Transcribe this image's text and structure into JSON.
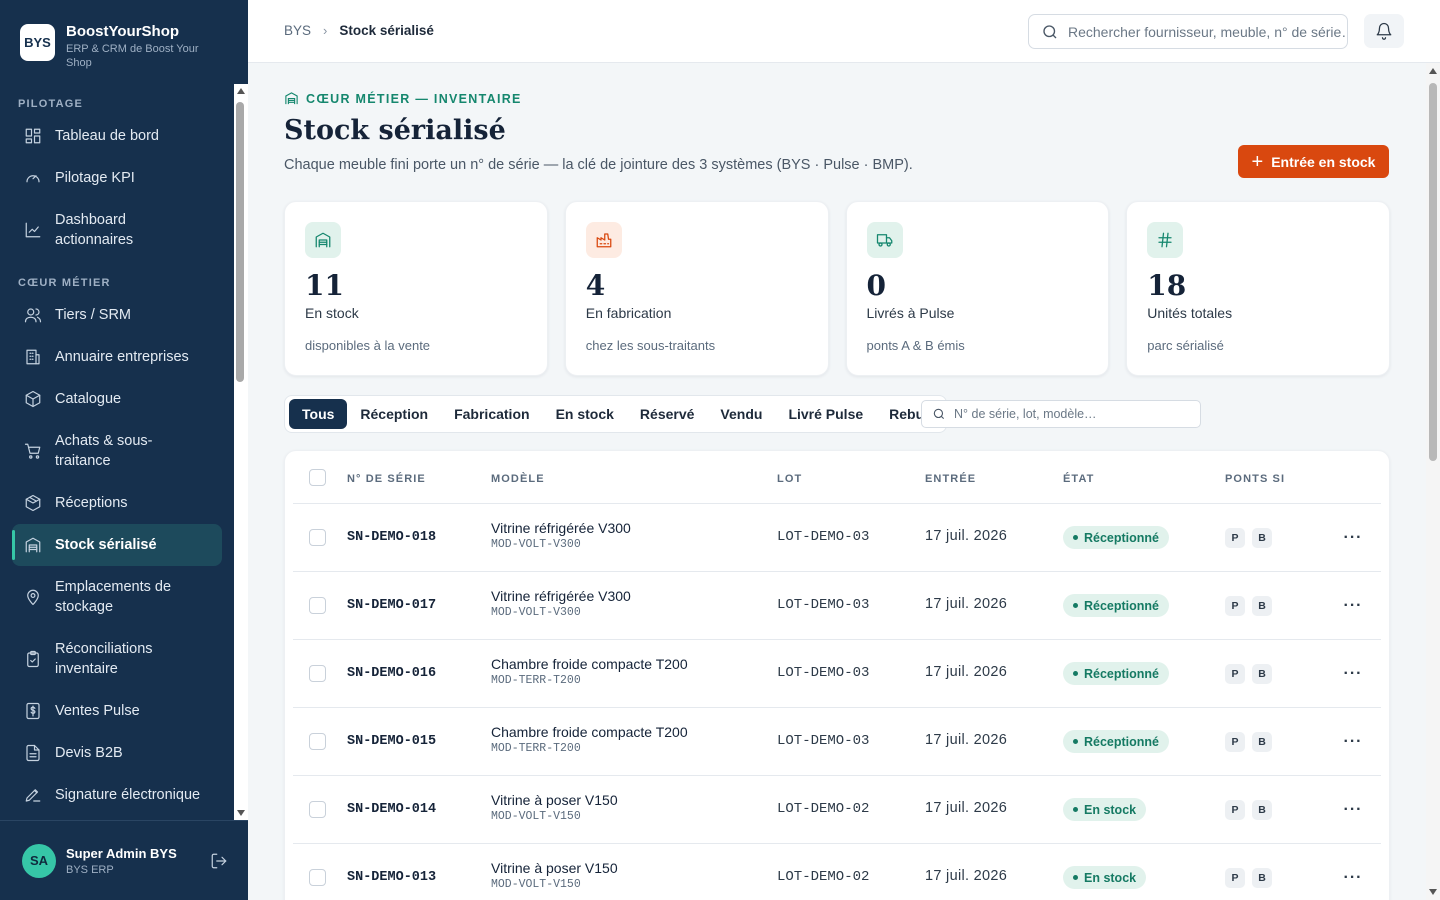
{
  "brand": {
    "logo": "BYS",
    "name": "BoostYourShop",
    "subtitle": "ERP & CRM de Boost Your Shop"
  },
  "sidebar": {
    "section_pilotage": "PILOTAGE",
    "section_coeur": "CŒUR MÉTIER",
    "items": [
      {
        "label": "Tableau de bord",
        "icon": "dashboard-icon"
      },
      {
        "label": "Pilotage KPI",
        "icon": "gauge-icon"
      },
      {
        "label": "Dashboard actionnaires",
        "icon": "chart-line-icon"
      },
      {
        "label": "Tiers / SRM",
        "icon": "users-icon"
      },
      {
        "label": "Annuaire entreprises",
        "icon": "building-icon"
      },
      {
        "label": "Catalogue",
        "icon": "box-icon"
      },
      {
        "label": "Achats & sous-traitance",
        "icon": "cart-icon"
      },
      {
        "label": "Réceptions",
        "icon": "package-check-icon"
      },
      {
        "label": "Stock sérialisé",
        "icon": "warehouse-icon"
      },
      {
        "label": "Emplacements de stockage",
        "icon": "map-pin-icon"
      },
      {
        "label": "Réconciliations inventaire",
        "icon": "clipboard-check-icon"
      },
      {
        "label": "Ventes Pulse",
        "icon": "dollar-file-icon"
      },
      {
        "label": "Devis B2B",
        "icon": "file-text-icon"
      },
      {
        "label": "Signature électronique",
        "icon": "signature-icon"
      }
    ],
    "active_index": 8
  },
  "user": {
    "initials": "SA",
    "name": "Super Admin BYS",
    "role": "BYS ERP"
  },
  "header": {
    "breadcrumb_root": "BYS",
    "breadcrumb_current": "Stock sérialisé",
    "search_placeholder": "Rechercher fournisseur, meuble, n° de série…"
  },
  "page": {
    "eyebrow": "CŒUR MÉTIER — INVENTAIRE",
    "title": "Stock sérialisé",
    "description": "Chaque meuble fini porte un n° de série — la clé de jointure des 3 systèmes (BYS · Pulse · BMP).",
    "primary_action": "Entrée en stock"
  },
  "kpis": [
    {
      "value": "11",
      "label": "En stock",
      "sub": "disponibles à la vente",
      "icon": "warehouse-icon",
      "color": "#15876e",
      "bg": "#e1f2ec"
    },
    {
      "value": "4",
      "label": "En fabrication",
      "sub": "chez les sous-traitants",
      "icon": "factory-icon",
      "color": "#d9480f",
      "bg": "#fdebe2"
    },
    {
      "value": "0",
      "label": "Livrés à Pulse",
      "sub": "ponts A & B émis",
      "icon": "truck-icon",
      "color": "#15876e",
      "bg": "#e1f2ec"
    },
    {
      "value": "18",
      "label": "Unités totales",
      "sub": "parc sérialisé",
      "icon": "hash-icon",
      "color": "#15876e",
      "bg": "#e1f2ec"
    }
  ],
  "filters": {
    "tabs": [
      "Tous",
      "Réception",
      "Fabrication",
      "En stock",
      "Réservé",
      "Vendu",
      "Livré Pulse",
      "Rebut"
    ],
    "active": "Tous",
    "search_placeholder": "N° de série, lot, modèle…"
  },
  "table": {
    "columns": {
      "serial": "N° DE SÉRIE",
      "model": "MODÈLE",
      "lot": "LOT",
      "entry": "ENTRÉE",
      "state": "ÉTAT",
      "bridges": "PONTS SI"
    },
    "rows": [
      {
        "serial": "SN-DEMO-018",
        "model": "Vitrine réfrigérée V300",
        "ref": "MOD-VOLT-V300",
        "lot": "LOT-DEMO-03",
        "entry": "17 juil. 2026",
        "state": "Réceptionné",
        "p": "P",
        "b": "B"
      },
      {
        "serial": "SN-DEMO-017",
        "model": "Vitrine réfrigérée V300",
        "ref": "MOD-VOLT-V300",
        "lot": "LOT-DEMO-03",
        "entry": "17 juil. 2026",
        "state": "Réceptionné",
        "p": "P",
        "b": "B"
      },
      {
        "serial": "SN-DEMO-016",
        "model": "Chambre froide compacte T200",
        "ref": "MOD-TERR-T200",
        "lot": "LOT-DEMO-03",
        "entry": "17 juil. 2026",
        "state": "Réceptionné",
        "p": "P",
        "b": "B"
      },
      {
        "serial": "SN-DEMO-015",
        "model": "Chambre froide compacte T200",
        "ref": "MOD-TERR-T200",
        "lot": "LOT-DEMO-03",
        "entry": "17 juil. 2026",
        "state": "Réceptionné",
        "p": "P",
        "b": "B"
      },
      {
        "serial": "SN-DEMO-014",
        "model": "Vitrine à poser V150",
        "ref": "MOD-VOLT-V150",
        "lot": "LOT-DEMO-02",
        "entry": "17 juil. 2026",
        "state": "En stock",
        "p": "P",
        "b": "B"
      },
      {
        "serial": "SN-DEMO-013",
        "model": "Vitrine à poser V150",
        "ref": "MOD-VOLT-V150",
        "lot": "LOT-DEMO-02",
        "entry": "17 juil. 2026",
        "state": "En stock",
        "p": "P",
        "b": "B"
      }
    ],
    "more_label": "···"
  }
}
